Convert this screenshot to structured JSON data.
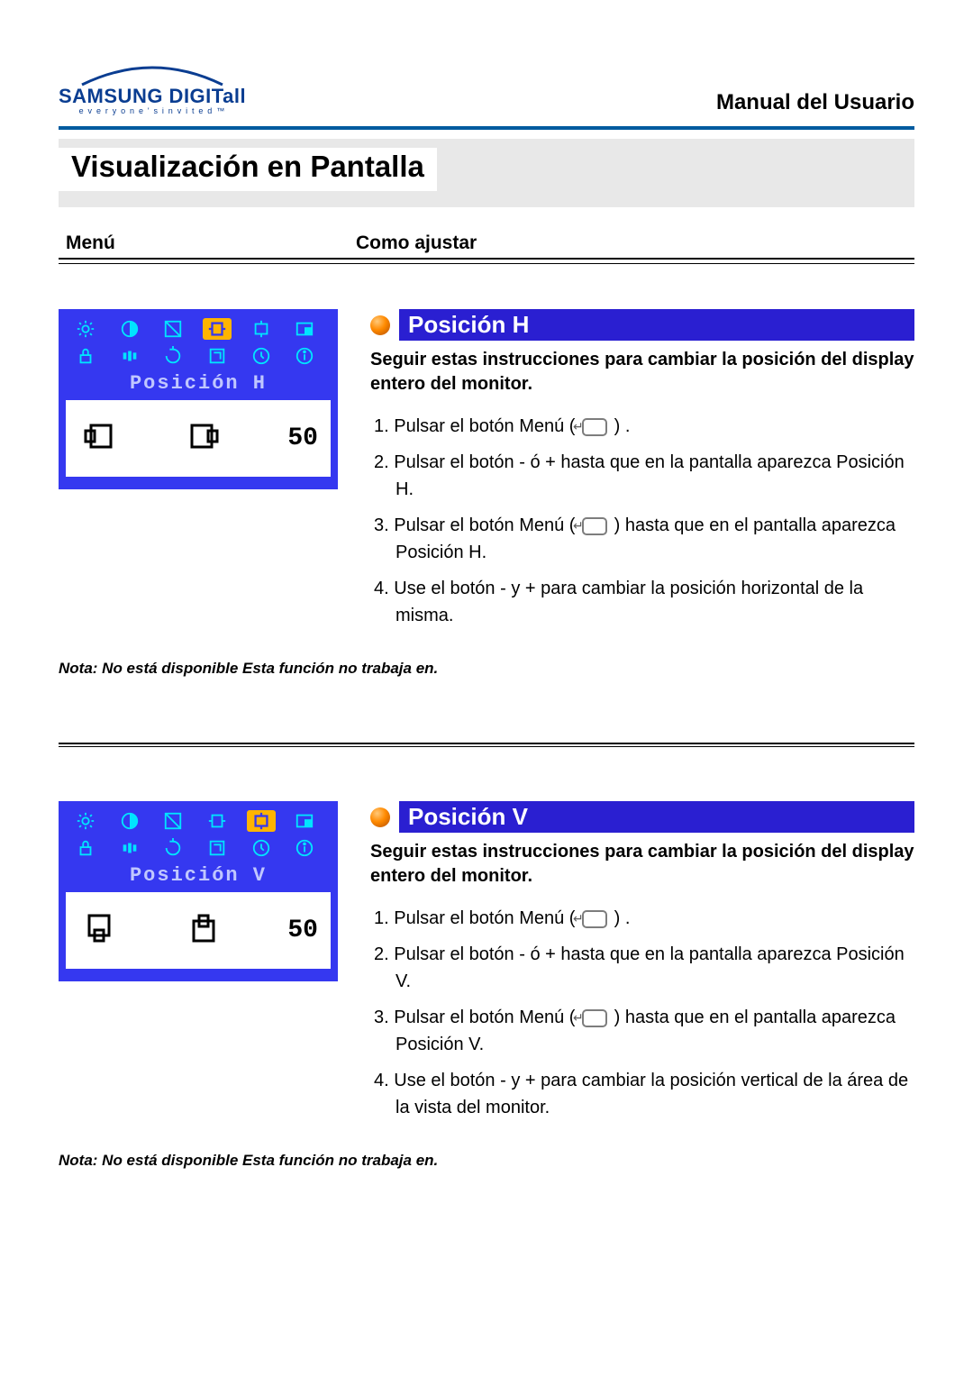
{
  "logo": {
    "brand": "SAMSUNG DIGITall",
    "tag": "e v e r y o n e ' s   i n v i t e d ™"
  },
  "manual_title": "Manual del Usuario",
  "page_title": "Visualización en Pantalla",
  "columns": {
    "left": "Menú",
    "right": "Como ajustar"
  },
  "section_h": {
    "osd_label": "Posición H",
    "osd_value": "50",
    "title": "Posición H",
    "subtitle": "Seguir estas instrucciones para cambiar la posición del display entero del monitor.",
    "steps": {
      "s1a": "Pulsar el botón Menú (",
      "s1b": ") .",
      "s2": "Pulsar el botón - ó + hasta que en la pantalla aparezca Posición H.",
      "s3a": "Pulsar el botón Menú  (",
      "s3b": ") hasta que en el pantalla aparezca Posición H.",
      "s4": "Use el botón - y + para cambiar la posición horizontal de la misma."
    },
    "note": "Nota: No está disponible  Esta función no trabaja en."
  },
  "section_v": {
    "osd_label": "Posición V",
    "osd_value": "50",
    "title": "Posición V",
    "subtitle": "Seguir estas instrucciones para cambiar la posición del display entero del monitor.",
    "steps": {
      "s1a": "Pulsar el botón Menú (",
      "s1b": ") .",
      "s2": "Pulsar el botón - ó + hasta que en la pantalla aparezca Posición V.",
      "s3a": "Pulsar el botón Menú (",
      "s3b": ") hasta que en el pantalla aparezca Posición V.",
      "s4": "Use el botón - y + para cambiar la posición vertical de la área de la vista del monitor."
    },
    "note": "Nota: No está disponible  Esta función no trabaja en."
  }
}
